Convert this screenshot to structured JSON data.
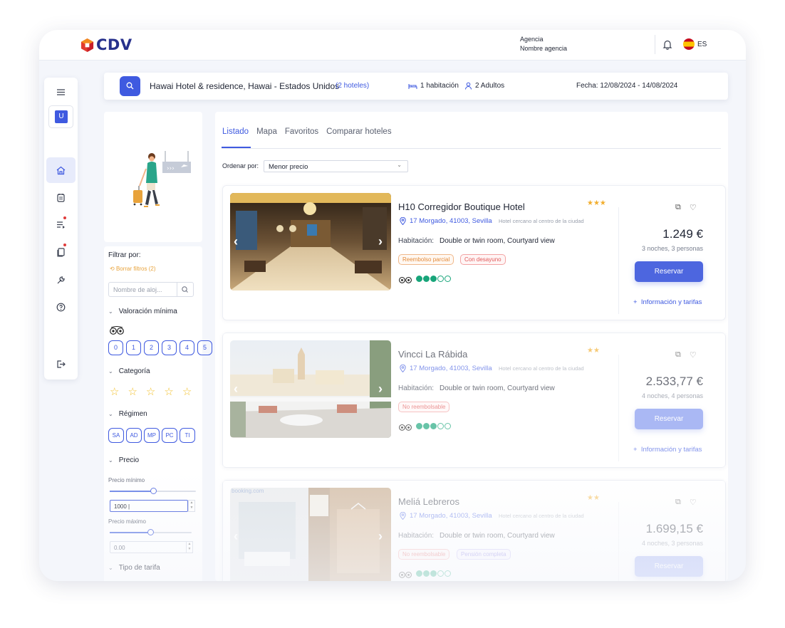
{
  "header": {
    "brand": "CDV",
    "agency_label": "Agencia",
    "agency_name": "Nombre agencia",
    "language": "ES"
  },
  "search": {
    "destination": "Hawai  Hotel & residence, Hawai - Estados Unidos",
    "hotel_count": "(2 hoteles)",
    "rooms": "1 habitación",
    "guests": "2 Adultos",
    "dates": "Fecha: 12/08/2024 - 14/08/2024"
  },
  "sidebar": {
    "user_initial": "U"
  },
  "filters": {
    "title": "Filtrar por:",
    "clear": "Borrar filtros (2)",
    "name_placeholder": "Nombre de aloj...",
    "rating_title": "Valoración mínima",
    "rating_options": [
      "0",
      "1",
      "2",
      "3",
      "4",
      "5"
    ],
    "category_title": "Categoría",
    "regime_title": "Régimen",
    "regime_options": [
      "SA",
      "AD",
      "MP",
      "PC",
      "TI"
    ],
    "price_title": "Precio",
    "price_min_label": "Precio mínimo",
    "price_min_value": "1000",
    "price_max_label": "Precio máximo",
    "price_max_value": "0.00",
    "rate_type_title": "Tipo de tarifa"
  },
  "tabs": [
    "Listado",
    "Mapa",
    "Favoritos",
    "Comparar hoteles"
  ],
  "sort": {
    "label": "Ordenar por:",
    "value": "Menor precio"
  },
  "hotels": [
    {
      "name": "H10 Corregidor Boutique Hotel",
      "stars": "★★★",
      "address": "17 Morgado, 41003, Sevilla",
      "note": "Hotel cercano al centro de la ciudad",
      "room_label": "Habitación:",
      "room": "Double or twin room, Courtyard view",
      "badges": [
        "Reembolso parcial",
        "Con desayuno"
      ],
      "price": "1.249 €",
      "nights": "3 noches, 3 personas",
      "book": "Reservar",
      "info": "Información y tarifas"
    },
    {
      "name": "Vincci La Rábida",
      "stars": "★★",
      "address": "17 Morgado, 41003, Sevilla",
      "note": "Hotel cercano al centro de la ciudad",
      "room_label": "Habitación:",
      "room": "Double or twin room, Courtyard view",
      "badges": [
        "No reembolsable"
      ],
      "price": "2.533,77 €",
      "nights": "4 noches, 4 personas",
      "book": "Reservar",
      "info": "Información y tarifas"
    },
    {
      "name": "Meliá Lebreros",
      "stars": "★★",
      "address": "17 Morgado, 41003, Sevilla",
      "note": "Hotel cercano al centro de la ciudad",
      "room_label": "Habitación:",
      "room": "Double or twin room, Courtyard view",
      "badges": [
        "No reembolsable",
        "Pensión completa"
      ],
      "price": "1.699,15 €",
      "nights": "4 noches, 3 personas",
      "book": "Reservar",
      "watermark": "booking.com"
    }
  ],
  "colors": {
    "accent": "#3f5ae0",
    "brand_navy": "#27318c",
    "star_gold": "#f2ae2e",
    "tripadvisor_green": "#18a57a"
  }
}
